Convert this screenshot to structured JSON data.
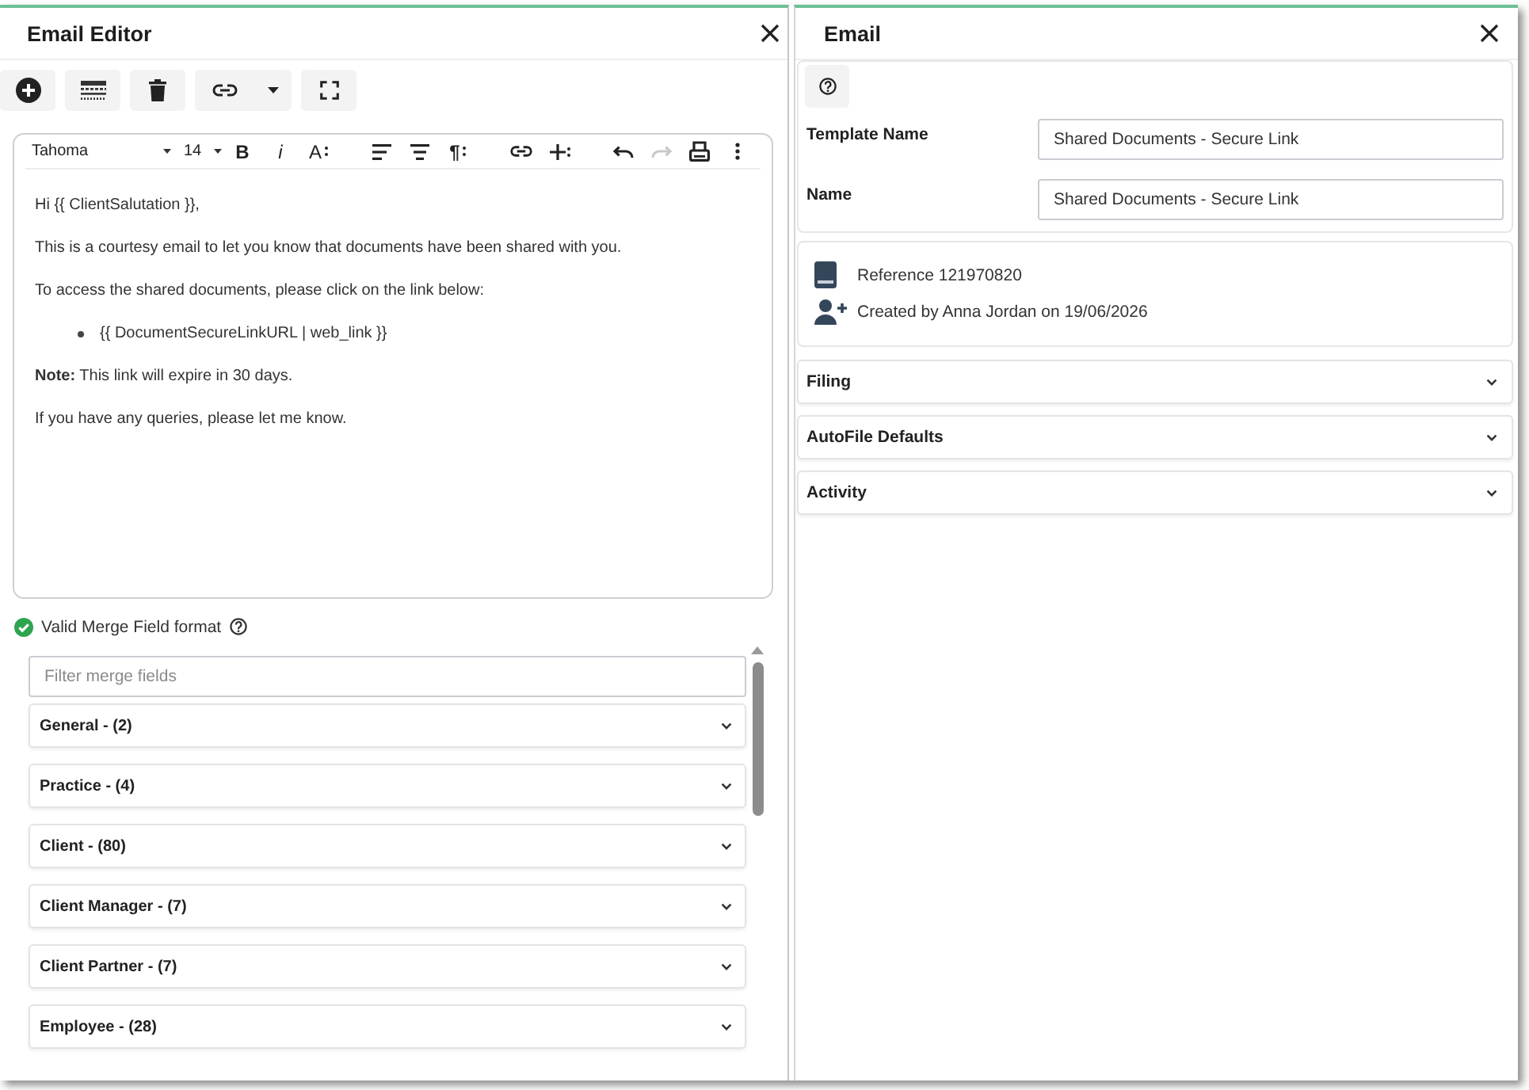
{
  "editor_panel": {
    "title": "Email Editor",
    "toolbar": [
      {
        "kind": "add"
      },
      {
        "kind": "table"
      },
      {
        "kind": "delete"
      },
      {
        "kind": "link"
      },
      {
        "kind": "fullscreen"
      }
    ],
    "format_bar": {
      "font": "Tahoma",
      "size": "14",
      "tool_groups": [
        [
          {
            "kind": "bold",
            "label": "B",
            "disabled": false
          },
          {
            "kind": "italic",
            "label": "i",
            "disabled": false
          },
          {
            "kind": "font-size",
            "label": "A",
            "disabled": false
          }
        ],
        [
          {
            "kind": "align-left",
            "disabled": false
          },
          {
            "kind": "align-center",
            "disabled": false
          },
          {
            "kind": "paragraph",
            "label": "¶",
            "disabled": false
          }
        ],
        [
          {
            "kind": "link",
            "disabled": false
          },
          {
            "kind": "insert",
            "disabled": false
          }
        ],
        [
          {
            "kind": "undo",
            "disabled": false
          },
          {
            "kind": "redo",
            "disabled": true
          },
          {
            "kind": "print",
            "disabled": false
          },
          {
            "kind": "more",
            "disabled": false
          }
        ]
      ]
    },
    "body": [
      {
        "kind": "paragraph",
        "text": "Hi {{ ClientSalutation }},"
      },
      {
        "kind": "paragraph",
        "text": "This is a courtesy email to let you know that documents have been shared with you."
      },
      {
        "kind": "paragraph",
        "text": "To access the shared documents, please click on the link below:"
      },
      {
        "kind": "bullet",
        "text": "{{ DocumentSecureLinkURL | web_link }}"
      },
      {
        "kind": "paragraph",
        "text": "**Note:** This link will expire in 30 days."
      },
      {
        "kind": "paragraph",
        "text": "If you have any queries, please let me know."
      }
    ],
    "validation": {
      "valid": true,
      "text": "Valid Merge Field format"
    },
    "filter": {
      "placeholder": "Filter merge fields"
    },
    "merge_groups": [
      {
        "label": "General - (2)",
        "expanded": false
      },
      {
        "label": "Practice - (4)",
        "expanded": false
      },
      {
        "label": "Client - (80)",
        "expanded": false
      },
      {
        "label": "Client Manager - (7)",
        "expanded": false
      },
      {
        "label": "Client Partner - (7)",
        "expanded": false
      },
      {
        "label": "Employee - (28)",
        "expanded": false
      }
    ]
  },
  "email_panel": {
    "title": "Email",
    "fields": [
      {
        "label": "Template Name",
        "value": "Shared Documents - Secure Link"
      },
      {
        "label": "Name",
        "value": "Shared Documents - Secure Link"
      }
    ],
    "info": [
      {
        "kind": "reference",
        "text": "Reference 121970820"
      },
      {
        "kind": "creator",
        "text": "Created by Anna Jordan on 19/06/2026"
      }
    ],
    "sections": [
      {
        "label": "Filing",
        "expanded": false
      },
      {
        "label": "AutoFile Defaults",
        "expanded": false
      },
      {
        "label": "Activity",
        "expanded": false
      }
    ]
  }
}
